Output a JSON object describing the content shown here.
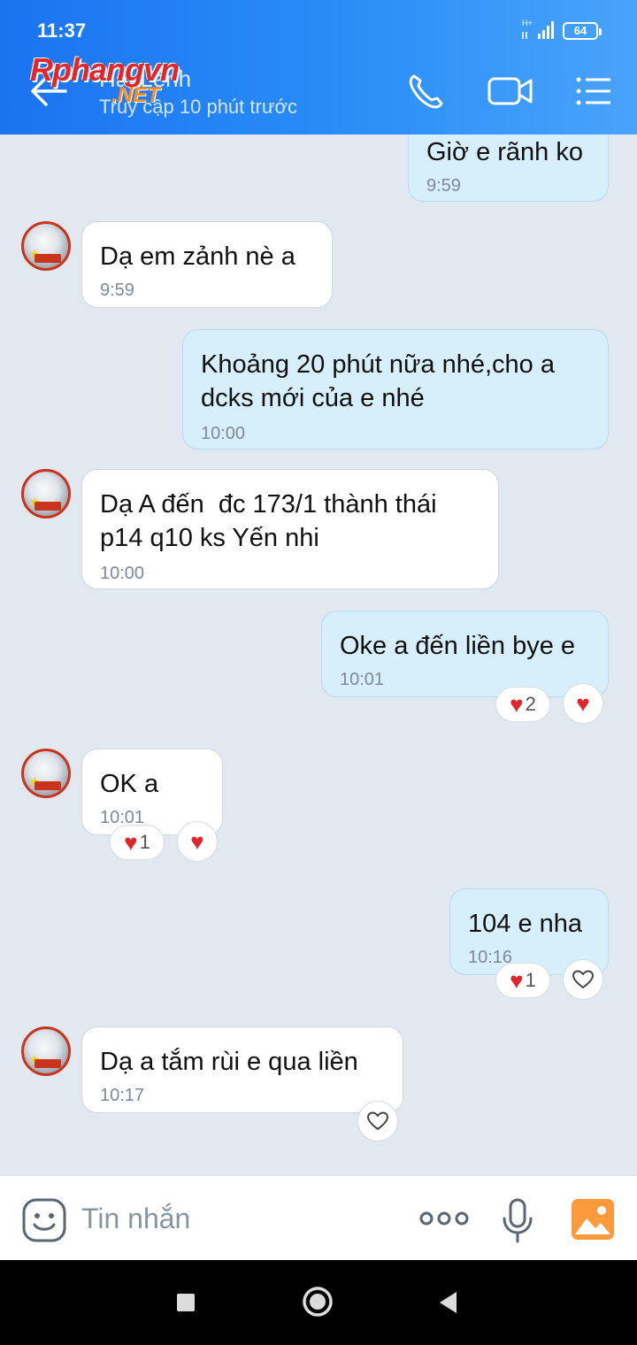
{
  "status_bar": {
    "time": "11:37",
    "network": "H+",
    "battery": "64"
  },
  "header": {
    "contact_name": "Hải Lệnh",
    "contact_status": "Truy cập 10 phút trước",
    "watermark_main": "Rphangvn",
    "watermark_sub": ".NET",
    "icons": [
      "back-arrow-icon",
      "phone-icon",
      "video-call-icon",
      "menu-list-icon"
    ]
  },
  "messages": [
    {
      "dir": "out",
      "lines": [
        "Giờ e rãnh ko"
      ],
      "time": "9:59"
    },
    {
      "dir": "in",
      "lines": [
        "Dạ em zảnh nè a"
      ],
      "time": "9:59"
    },
    {
      "dir": "out",
      "lines": [
        "Khoảng 20 phút nữa nhé,cho a",
        "dcks mới của e nhé"
      ],
      "time": "10:00"
    },
    {
      "dir": "in",
      "lines": [
        "Dạ A đến  đc 173/1 thành thái",
        "p14 q10 ks Yến nhi"
      ],
      "time": "10:00"
    },
    {
      "dir": "out",
      "lines": [
        "Oke a đến liền bye e"
      ],
      "time": "10:01",
      "reaction_count": "2"
    },
    {
      "dir": "in",
      "lines": [
        "OK a"
      ],
      "time": "10:01",
      "reaction_count": "1"
    },
    {
      "dir": "out",
      "lines": [
        "104 e nha"
      ],
      "time": "10:16",
      "reaction_count": "1"
    },
    {
      "dir": "in",
      "lines": [
        "Dạ a tắm rùi e qua liền"
      ],
      "time": "10:17"
    }
  ],
  "input_bar": {
    "placeholder": "Tin nhắn",
    "icons": [
      "emoji-icon",
      "more-options-icon",
      "microphone-icon",
      "image-gallery-icon"
    ]
  },
  "colors": {
    "header_start": "#1a73f0",
    "header_end": "#4aa3fb",
    "outgoing_bubble": "#d7eefb",
    "incoming_bubble": "#ffffff",
    "chat_background": "#e2e8ef",
    "reaction_heart": "#e0262c",
    "gallery_icon": "#ff9a3c"
  }
}
